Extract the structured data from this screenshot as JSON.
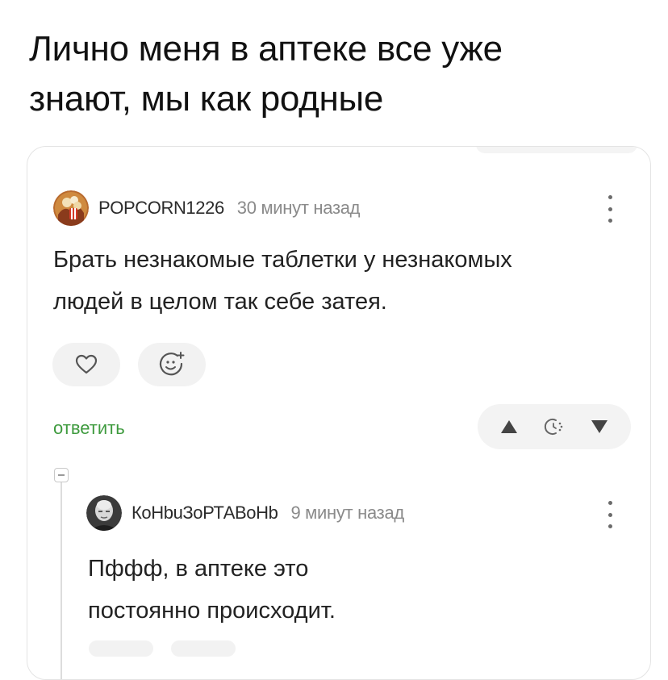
{
  "meme": {
    "title_line1": "Лично меня в аптеке все уже",
    "title_line2": "знают, мы как родные"
  },
  "comment": {
    "username": "POPCORN1226",
    "time": "30 минут назад",
    "text_line1": "Брать незнакомые таблетки у незнакомых",
    "text_line2": "людей в целом так себе затея.",
    "reply_label": "ответить",
    "avatar_icon": "popcorn-avatar",
    "like_icon": "heart-outline-icon",
    "emoji_icon": "add-emoji-icon",
    "menu_icon": "kebab-menu-icon"
  },
  "vote": {
    "up_icon": "triangle-up-icon",
    "rating_icon": "hidden-rating-clock-icon",
    "down_icon": "triangle-down-icon"
  },
  "reply": {
    "username": "КоНbuЗоРТАВоНb",
    "time": "9 минут назад",
    "text_line1": "Пффф, в аптеке это",
    "text_line2": "постоянно происходит.",
    "avatar_icon": "bald-man-avatar",
    "menu_icon": "kebab-menu-icon"
  },
  "colors": {
    "reply_link": "#3f9b3f",
    "card_border": "#e4e4e4",
    "button_bg": "#f2f2f2"
  }
}
